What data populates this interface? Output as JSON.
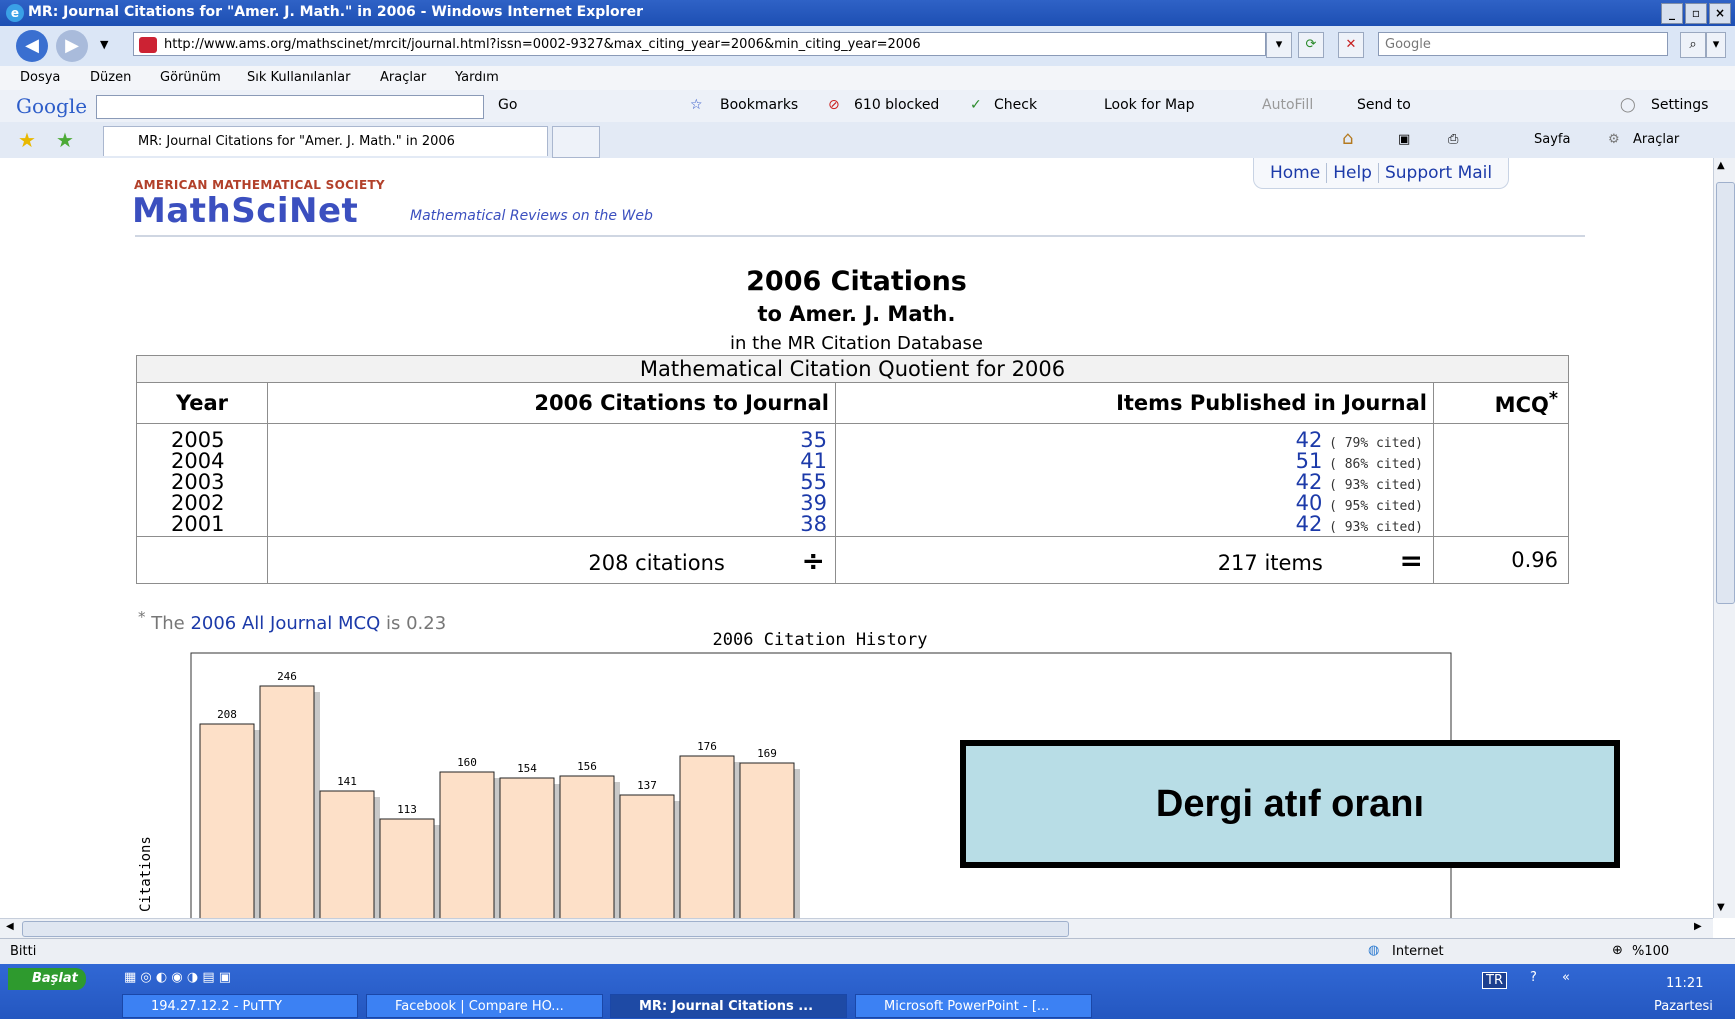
{
  "window": {
    "title": "MR: Journal Citations for \"Amer. J. Math.\" in 2006 - Windows Internet Explorer",
    "controls": [
      "_",
      "▫",
      "×"
    ]
  },
  "address_bar": {
    "url": "http://www.ams.org/mathscinet/mrcit/journal.html?issn=0002-9327&max_citing_year=2006&min_citing_year=2006",
    "search_placeholder": "Google"
  },
  "menu": [
    "Dosya",
    "Düzen",
    "Görünüm",
    "Sık Kullanılanlar",
    "Araçlar",
    "Yardım"
  ],
  "google_toolbar": {
    "logo": "Google",
    "go": "Go",
    "bookmarks": "Bookmarks",
    "blocked": "610 blocked",
    "check": "Check",
    "look_for_map": "Look for Map",
    "autofill": "AutoFill",
    "send_to": "Send to",
    "settings": "Settings"
  },
  "tab": {
    "label": "MR: Journal Citations for \"Amer. J. Math.\" in 2006",
    "cmd_page": "Sayfa",
    "cmd_tools": "Araçlar"
  },
  "page": {
    "nav_links": [
      "Home",
      "Help",
      "Support Mail"
    ],
    "ams": "AMERICAN MATHEMATICAL SOCIETY",
    "brand": "MathSciNet",
    "tagline": "Mathematical Reviews on the Web",
    "heading": "2006 Citations",
    "subheading": "to Amer. J. Math.",
    "subsubheading": "in the MR Citation Database",
    "table": {
      "caption": "Mathematical Citation Quotient for 2006",
      "headers": [
        "Year",
        "2006 Citations to Journal",
        "Items Published in Journal",
        "MCQ"
      ],
      "mcq_star": "*",
      "rows": [
        {
          "year": "2005",
          "citations": "35",
          "items": "42",
          "pct": "( 79% cited)"
        },
        {
          "year": "2004",
          "citations": "41",
          "items": "51",
          "pct": "( 86% cited)"
        },
        {
          "year": "2003",
          "citations": "55",
          "items": "42",
          "pct": "( 93% cited)"
        },
        {
          "year": "2002",
          "citations": "39",
          "items": "40",
          "pct": "( 95% cited)"
        },
        {
          "year": "2001",
          "citations": "38",
          "items": "42",
          "pct": "( 93% cited)"
        }
      ],
      "total_citations": "208 citations",
      "div_sign": "÷",
      "total_items": "217 items",
      "eq_sign": "=",
      "mcq": "0.96"
    },
    "note_star": "*",
    "note_pre": "The",
    "note_link": "2006 All Journal MCQ",
    "note_post": "is 0.23",
    "overlay": "Dergi atıf oranı"
  },
  "chart_data": {
    "type": "bar",
    "title": "2006 Citation History",
    "ylabel": "Citations",
    "values": [
      208,
      246,
      141,
      113,
      160,
      154,
      156,
      137,
      176,
      169
    ],
    "ylim": [
      0,
      260
    ],
    "bar_color": "#fde0c8"
  },
  "status": {
    "text": "Bitti",
    "zone": "Internet",
    "zoom": "%100"
  },
  "taskbar": {
    "start": "Başlat",
    "tasks": [
      "194.27.12.2 - PuTTY",
      "Facebook | Compare HO...",
      "MR: Journal Citations ...",
      "Microsoft PowerPoint - [..."
    ],
    "lang": "TR",
    "time": "11:21",
    "day": "Pazartesi"
  }
}
